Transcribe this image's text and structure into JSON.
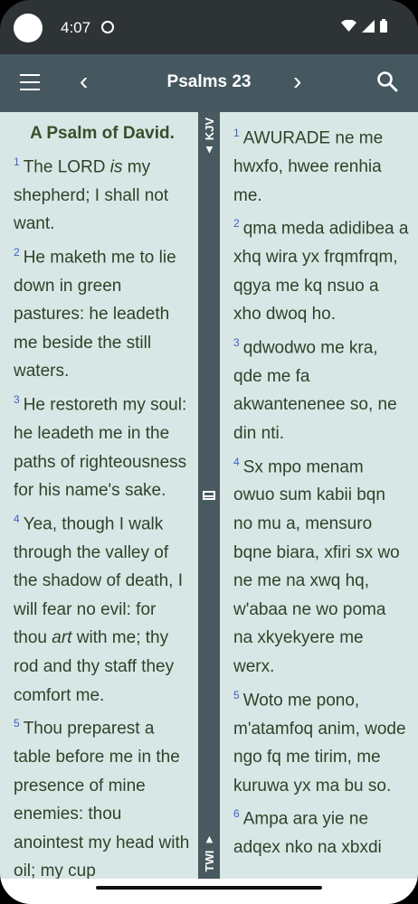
{
  "status_bar": {
    "time": "4:07"
  },
  "app_bar": {
    "title": "Psalms 23",
    "prev_symbol": "‹",
    "next_symbol": "›"
  },
  "divider": {
    "top_label": "KJV",
    "top_arrow": "▲",
    "bottom_label": "TWI",
    "bottom_arrow": "▼"
  },
  "kjv": {
    "heading": "A Psalm of David.",
    "verses": [
      {
        "num": "1",
        "pre": "The LORD ",
        "em": "is",
        "post": " my shepherd; I shall not want."
      },
      {
        "num": "2",
        "pre": "He maketh me to lie down in green pastures: he leadeth me beside the still waters.",
        "em": "",
        "post": ""
      },
      {
        "num": "3",
        "pre": "He restoreth my soul: he leadeth me in the paths of righteousness for his name's sake.",
        "em": "",
        "post": ""
      },
      {
        "num": "4",
        "pre": "Yea, though I walk through the valley of the shadow of death, I will fear no evil: for thou ",
        "em": "art",
        "post": " with me; thy rod and thy staff they comfort me."
      },
      {
        "num": "5",
        "pre": "Thou preparest a table before me in the presence of mine enemies: thou anointest my head with oil; my cup",
        "em": "",
        "post": ""
      }
    ]
  },
  "twi": {
    "verses": [
      {
        "num": "1",
        "text": "AWURADE ne me hwxfo, hwee renhia me."
      },
      {
        "num": "2",
        "text": "qma meda adidibea a xhq wira yx frqmfrqm, qgya me kq nsuo a xho dwoq ho."
      },
      {
        "num": "3",
        "text": "qdwodwo me kra, qde me fa akwantenenee so, ne din nti."
      },
      {
        "num": "4",
        "text": "Sx mpo menam owuo sum kabii bqn no mu a, mensuro bqne biara, xfiri sx wo ne me na xwq hq, w'abaa ne wo poma na xkyekyere me werx."
      },
      {
        "num": "5",
        "text": "Woto me pono, m'atamfoq anim, wode ngo fq me tirim, me kuruwa yx ma bu so."
      },
      {
        "num": "6",
        "text": "Ampa ara yie ne adqex nko na xbxdi"
      }
    ]
  }
}
